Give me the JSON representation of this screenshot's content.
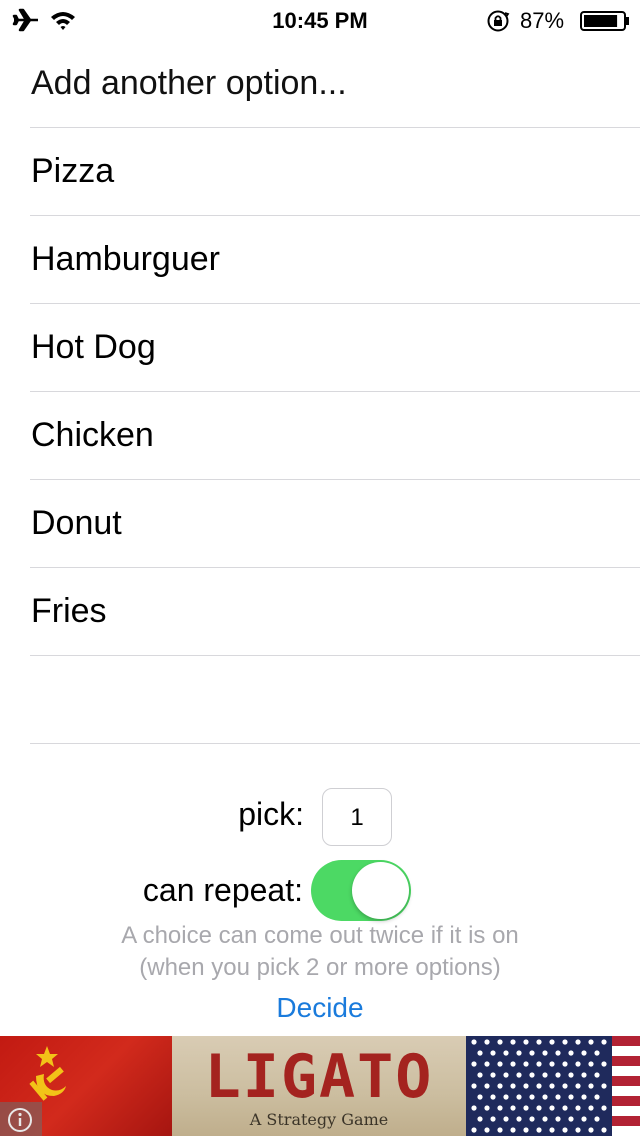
{
  "status_bar": {
    "time": "10:45 PM",
    "battery_percent": "87%",
    "battery_level": 0.87,
    "icons": [
      "airplane-mode-icon",
      "wifi-icon",
      "orientation-lock-icon",
      "battery-icon"
    ]
  },
  "options": {
    "add_placeholder": "Add another option...",
    "items": [
      "Pizza",
      "Hamburguer",
      "Hot Dog",
      "Chicken",
      "Donut",
      "Fries"
    ]
  },
  "controls": {
    "pick_label": "pick:",
    "pick_value": "1",
    "repeat_label": "can repeat:",
    "repeat_on": true,
    "hint_line1": "A choice can come out twice if it is on",
    "hint_line2": "(when you pick 2 or more options)",
    "decide_label": "Decide"
  },
  "ad": {
    "title": "LIGATO",
    "tagline": "A Strategy Game"
  },
  "colors": {
    "toggle_on": "#4cd964",
    "link_blue": "#1a7bdc",
    "hint_gray": "#a8a8ad",
    "separator": "#d8d8dc"
  }
}
